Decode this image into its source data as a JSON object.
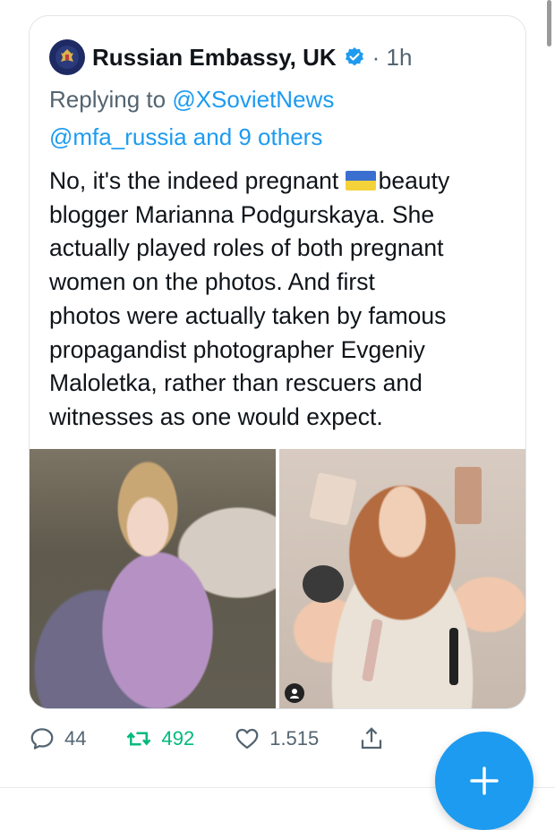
{
  "tweet": {
    "display_name": "Russian Embassy, UK",
    "time": "· 1h",
    "replying_prefix": "Replying to ",
    "reply_handle": "@XSovietNews",
    "reply_others": "@mfa_russia and 9 others",
    "text_part1": "No, it's the indeed pregnant ",
    "text_part2": "beauty\nblogger Marianna Podgurskaya. She\nactually played roles of both pregnant\nwomen on the photos. And first\nphotos were actually taken by famous\npropagandist photographer Evgeniy\nMaloletka, rather than rescuers and\nwitnesses as one would expect."
  },
  "actions": {
    "replies": "44",
    "retweets": "492",
    "likes": "1.515"
  },
  "colors": {
    "accent": "#1d9bf0",
    "retweet": "#00ba7c",
    "muted": "#536471"
  },
  "icons": [
    "embassy-emblem-icon",
    "verified-badge-icon",
    "ukraine-flag-icon",
    "reply-icon",
    "retweet-icon",
    "like-icon",
    "share-icon",
    "compose-plus-icon",
    "person-tag-icon"
  ]
}
